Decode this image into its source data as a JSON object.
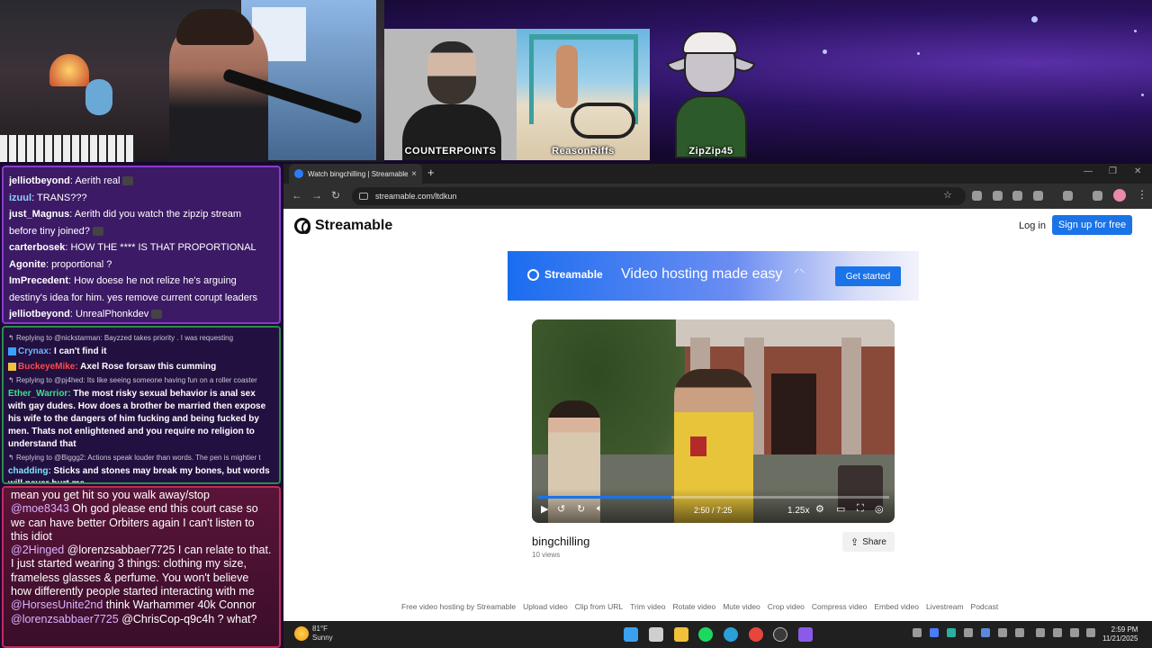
{
  "stream": {
    "tiles": [
      {
        "label": "COUNTERPOINTS"
      },
      {
        "label": "ReasonRiffs"
      },
      {
        "label": "ZipZip45"
      }
    ]
  },
  "twitch_chat": [
    {
      "user": "jelliotbeyond",
      "text": ": Aerith real"
    },
    {
      "user": "izuul",
      "text": ": TRANS???"
    },
    {
      "user": "just_Magnus",
      "text": ": Aerith did you watch the zipzip stream"
    },
    {
      "user": "",
      "text": "before tiny joined?"
    },
    {
      "user": "carterbosek",
      "text": ": HOW THE **** IS THAT PROPORTIONAL"
    },
    {
      "user": "Agonite",
      "text": ": proportional ?"
    },
    {
      "user": "ImPrecedent",
      "text": ": How doese he not relize he's arguing"
    },
    {
      "user": "",
      "text": "destiny's idea for him. yes remove current corupt leaders"
    },
    {
      "user": "jelliotbeyond",
      "text": ": UnrealPhonkdev"
    }
  ],
  "youtube_chat": {
    "reply1": "Replying to @nickstarman: Bayzzed     takes priority     . I was requesting",
    "msg1_user": "Crynax:",
    "msg1_text": " I can't find it",
    "msg2_user": "BuckeyeMike:",
    "msg2_text": " Axel Rose forsaw this cumming",
    "reply2": "Replying to @pj4hed: Its like seeing someone having fun on a roller coaster",
    "msg3_user": "Ether_Warrior:",
    "msg3_text": " The most risky sexual behavior is anal sex with gay dudes. How does a brother be married then expose his wife to the dangers of him fucking and being fucked by men. Thats not enlightened and you require no religion to understand that",
    "reply3": "Replying to @Biggg2: Actions speak louder than words. The pen is mightier t",
    "msg4_user": "chadding:",
    "msg4_text": " Sticks and stones may break my bones, but words will never hurt me."
  },
  "kick_chat": [
    {
      "user": "",
      "text": "mean you get hit so you walk away/stop"
    },
    {
      "user": "@moe8343",
      "text": " Oh god please end this court case so we can have better Orbiters again I can't listen to this idiot"
    },
    {
      "user": "@2Hinged",
      "text": " @lorenzsabbaer7725 I can relate to that. I just started wearing 3 things: clothing my size, frameless glasses & perfume. You won't believe how differently people started interacting with me"
    },
    {
      "user": "@HorsesUnite2nd",
      "text": " think Warhammer 40k Connor"
    },
    {
      "user": "@lorenzsabbaer7725",
      "text": " @ChrisCop-q9c4h ? what?"
    }
  ],
  "browser": {
    "tab_title": "Watch bingchilling | Streamable",
    "url": "streamable.com/ltdkun",
    "new_tab": "+",
    "tab_close": "×"
  },
  "page": {
    "logo_text": "Streamable",
    "login": "Log in",
    "signup": "Sign up for free",
    "banner": {
      "logo_text": "Streamable",
      "tagline": "Video hosting made easy",
      "cta": "Get started"
    },
    "video": {
      "current_time": "2:50",
      "duration": "7:25",
      "time_display": "2:50 / 7:25",
      "speed": "1.25x",
      "progress": 0.38
    },
    "title": "bingchilling",
    "views": "10 views",
    "share": "Share",
    "footer_links": [
      "Free video hosting by Streamable",
      "Upload video",
      "Clip from URL",
      "Trim video",
      "Rotate video",
      "Mute video",
      "Crop video",
      "Compress video",
      "Embed video",
      "Livestream",
      "Podcast"
    ]
  },
  "taskbar": {
    "temp": "81°F",
    "condition": "Sunny",
    "time": "2:59 PM",
    "date": "11/21/2025"
  },
  "colors": {
    "accent": "#1a73e8",
    "twitch_border": "#8a3cc8",
    "youtube_border": "#2c8c4a",
    "kick_border": "#c42a5a"
  }
}
